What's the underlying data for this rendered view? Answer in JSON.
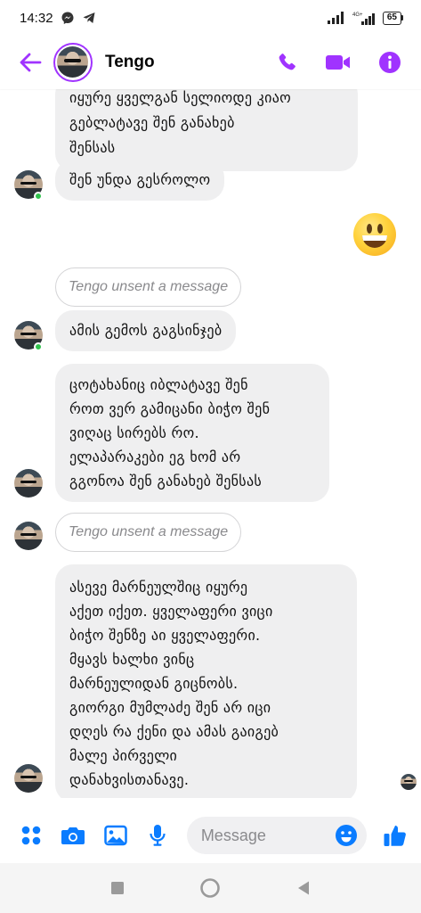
{
  "status_bar": {
    "time": "14:32",
    "battery": "65",
    "network": "4G+"
  },
  "header": {
    "contact_name": "Tengo",
    "accent_color": "#a033ff"
  },
  "messages": [
    {
      "type": "received",
      "text": "იყურე ყველგან სელიოდე კიაო\nგებლატავე შენ განახებ\nშენსას"
    },
    {
      "type": "received",
      "text": "შენ უნდა გესროლო"
    },
    {
      "type": "sent_emoji",
      "icon": "grinning-face-emoji"
    },
    {
      "type": "unsent",
      "text": "Tengo unsent a message"
    },
    {
      "type": "received",
      "text": "ამის გემოს გაგსინჯებ"
    },
    {
      "type": "received",
      "text": "ცოტახანიც იბლატავე შენ\nროთ ვერ გამიცანი ბიჭო შენ\nვიღაც სირებს რო.\nელაპარაკები ეგ ხომ არ\nგგონოა შენ განახებ შენსას"
    },
    {
      "type": "unsent",
      "text": "Tengo unsent a message"
    },
    {
      "type": "received",
      "text": "ასევე მარნეულშიც იყურე\nაქეთ იქეთ. ყველაფერი ვიცი\nბიჭო შენზე აი ყველაფერი.\nმყავს ხალხი ვინც\nმარნეულიდან გიცნობს.\nგიორგი მუმლაძე შენ არ იცი\nდღეს რა ქენი და ამას გაიგებ\nმალე პირველი\nდანახვისთანავე."
    }
  ],
  "composer": {
    "placeholder": "Message"
  }
}
